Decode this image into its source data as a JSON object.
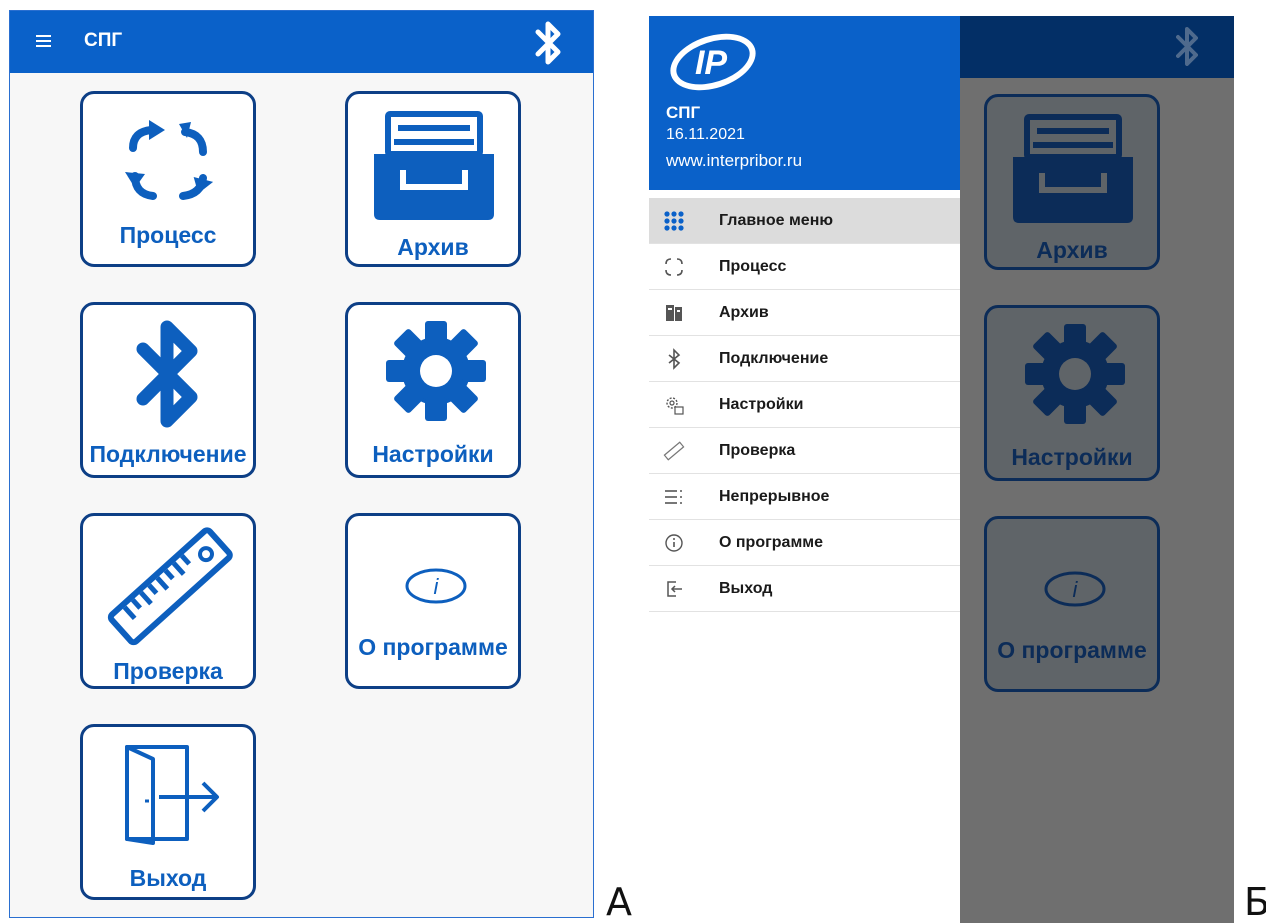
{
  "screen_a": {
    "app_title": "СПГ",
    "tiles": {
      "process": "Процесс",
      "archive": "Архив",
      "connect": "Подключение",
      "settings": "Настройки",
      "check": "Проверка",
      "about": "О программе",
      "exit": "Выход"
    },
    "panel_label": "А"
  },
  "screen_b": {
    "drawer": {
      "title": "СПГ",
      "date": "16.11.2021",
      "site": "www.interpribor.ru",
      "items": [
        {
          "label": "Главное меню",
          "icon": "grid-icon",
          "active": true
        },
        {
          "label": "Процесс",
          "icon": "process-icon"
        },
        {
          "label": "Архив",
          "icon": "archive-icon"
        },
        {
          "label": "Подключение",
          "icon": "bluetooth-icon"
        },
        {
          "label": "Настройки",
          "icon": "settings-icon"
        },
        {
          "label": "Проверка",
          "icon": "ruler-icon"
        },
        {
          "label": "Непрерывное",
          "icon": "list-icon"
        },
        {
          "label": "О программе",
          "icon": "info-icon"
        },
        {
          "label": "Выход",
          "icon": "exit-icon"
        }
      ]
    },
    "background_tiles": {
      "archive": "Архив",
      "settings": "Настройки",
      "about": "О программе"
    },
    "panel_label": "Б"
  },
  "colors": {
    "primary": "#0a61c9",
    "tile_border": "#0d3f86",
    "tile_text": "#0d5fbe",
    "overlay": "#6f6f6f"
  }
}
